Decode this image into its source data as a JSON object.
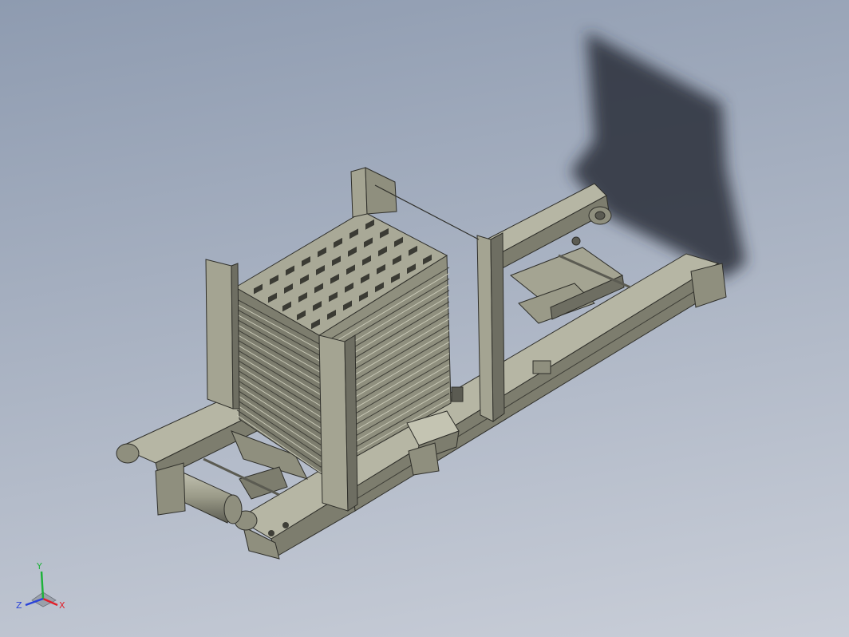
{
  "viewport": {
    "background_top": "#8e9bb0",
    "background_bottom": "#c9ced8"
  },
  "model": {
    "body_color": "#8f8f7e",
    "dark_color": "#5b5b52",
    "light_color": "#b6b6a4",
    "line_color": "#2f2f2a",
    "shadow_color": "#2c3038"
  },
  "triad": {
    "x_label": "X",
    "y_label": "Y",
    "z_label": "Z",
    "x_color": "#e0202a",
    "y_color": "#1fb23b",
    "z_color": "#2a43d8"
  }
}
